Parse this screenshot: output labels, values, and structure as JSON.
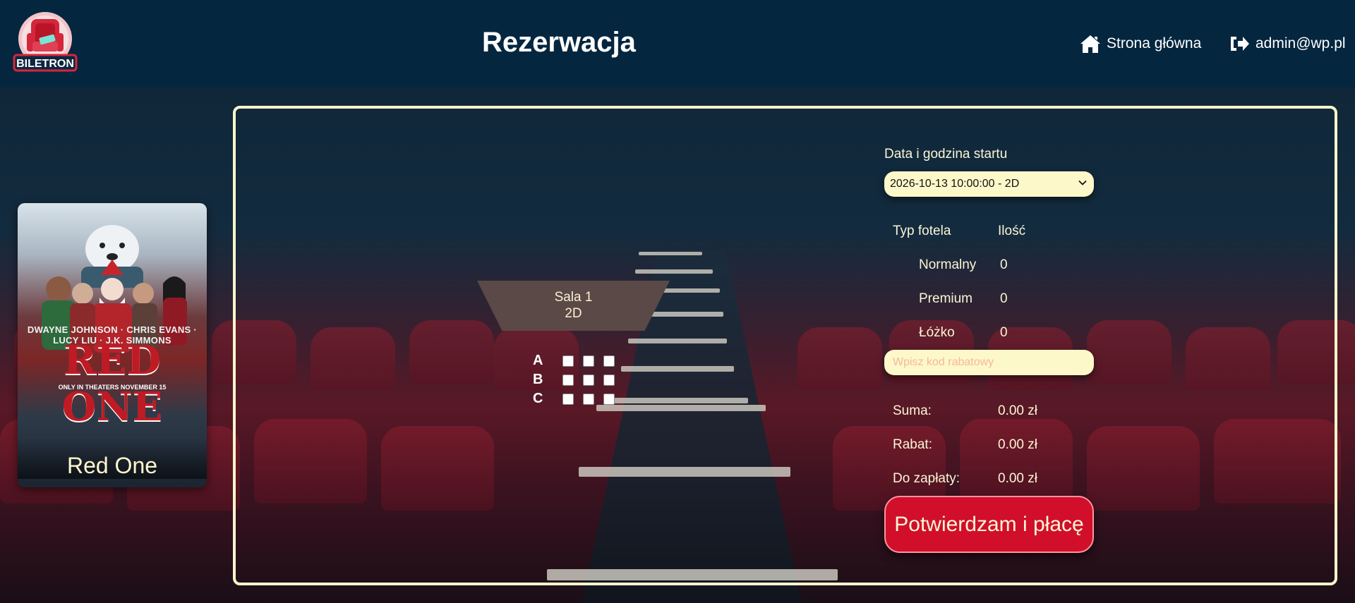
{
  "header": {
    "logo_text": "BILETRON",
    "title": "Rezerwacja",
    "home_label": "Strona główna",
    "user_label": "admin@wp.pl"
  },
  "movie": {
    "poster_caption": "Red One",
    "poster_names": "DWAYNE JOHNSON · CHRIS EVANS · LUCY LIU · J.K. SIMMONS",
    "poster_title": "RED ONE",
    "poster_tagline": "ONLY IN THEATERS NOVEMBER 15"
  },
  "hall": {
    "name": "Sala 1",
    "format": "2D",
    "rows": [
      {
        "label": "A",
        "seats": 3
      },
      {
        "label": "B",
        "seats": 3
      },
      {
        "label": "C",
        "seats": 3
      }
    ]
  },
  "booking": {
    "datetime_label": "Data i godzina startu",
    "datetime_value": "2026-10-13 10:00:00 - 2D",
    "seat_type_header": "Typ fotela",
    "qty_header": "Ilość",
    "seat_types": [
      {
        "name": "Normalny",
        "qty": "0"
      },
      {
        "name": "Premium",
        "qty": "0"
      },
      {
        "name": "Łóżko",
        "qty": "0"
      }
    ],
    "discount_placeholder": "Wpisz kod rabatowy",
    "sum_label": "Suma:",
    "sum_value": "0.00 zł",
    "discount_label": "Rabat:",
    "discount_value": "0.00 zł",
    "total_label": "Do zapłaty:",
    "total_value": "0.00 zł",
    "pay_button": "Potwierdzam i płacę"
  },
  "colors": {
    "header_bg": "#05263f",
    "frame_border": "#fbf5cc",
    "input_bg": "#fdf8c9",
    "pay_button_bg": "#d10f2a"
  },
  "icons": {
    "home": "home-icon",
    "logout": "sign-out-icon",
    "dropdown": "chevron-down-icon"
  }
}
